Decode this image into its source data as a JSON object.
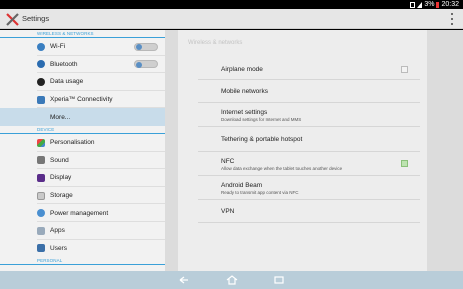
{
  "status_bar": {
    "battery": "3%",
    "time": "20:32"
  },
  "app": {
    "title": "Settings"
  },
  "sidebar": {
    "sections": [
      {
        "header": "WIRELESS & NETWORKS",
        "items": [
          {
            "label": "Wi-Fi",
            "icon": "wifi-icon",
            "toggle": true
          },
          {
            "label": "Bluetooth",
            "icon": "bluetooth-icon",
            "toggle": true
          },
          {
            "label": "Data usage",
            "icon": "data-usage-icon"
          },
          {
            "label": "Xperia™ Connectivity",
            "icon": "xperia-connectivity-icon"
          },
          {
            "label": "More...",
            "selected": true
          }
        ]
      },
      {
        "header": "DEVICE",
        "items": [
          {
            "label": "Personalisation",
            "icon": "personalisation-icon"
          },
          {
            "label": "Sound",
            "icon": "sound-icon"
          },
          {
            "label": "Display",
            "icon": "display-icon"
          },
          {
            "label": "Storage",
            "icon": "storage-icon"
          },
          {
            "label": "Power management",
            "icon": "power-icon"
          },
          {
            "label": "Apps",
            "icon": "apps-icon"
          },
          {
            "label": "Users",
            "icon": "users-icon"
          }
        ]
      },
      {
        "header": "PERSONAL",
        "items": []
      }
    ]
  },
  "detail": {
    "header": "Wireless & networks",
    "rows": [
      {
        "title": "Airplane mode",
        "checkbox": "unchecked"
      },
      {
        "title": "Mobile networks"
      },
      {
        "title": "Internet settings",
        "subtitle": "Download settings for Internet and MMS"
      },
      {
        "title": "Tethering & portable hotspot"
      },
      {
        "title": "NFC",
        "subtitle": "Allow data exchange when the tablet touches another device",
        "checkbox": "checked"
      },
      {
        "title": "Android Beam",
        "subtitle": "Ready to transmit app content via NFC"
      },
      {
        "title": "VPN"
      }
    ]
  },
  "colors": {
    "accent": "#3aa0d8",
    "selected": "#c8dcea",
    "navbar": "#b9cdd9"
  }
}
